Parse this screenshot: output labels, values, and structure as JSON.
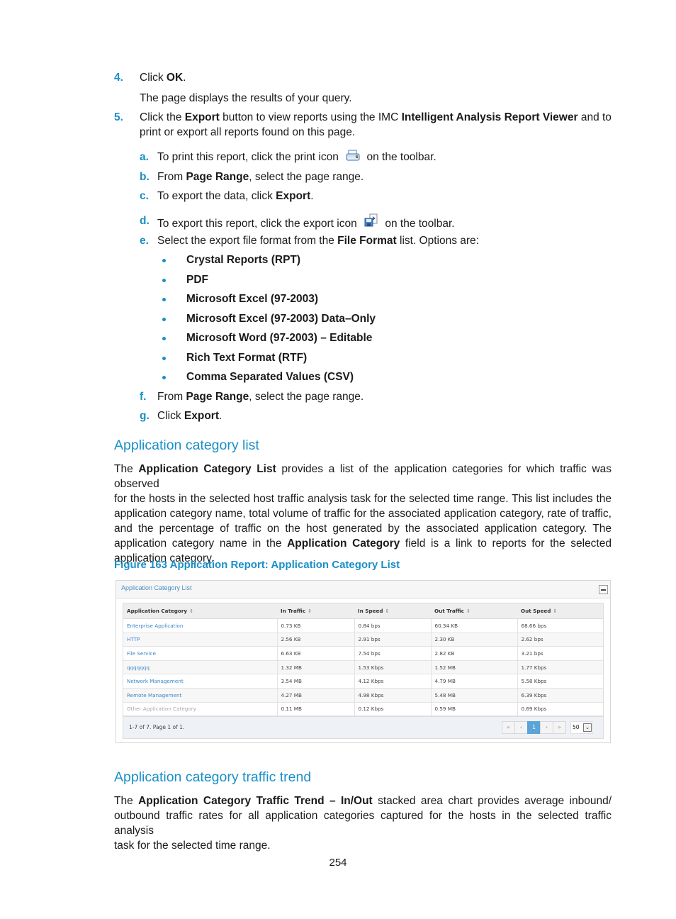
{
  "steps": {
    "step4": {
      "num": "4.",
      "pre": "Click ",
      "bold": "OK",
      "post": ".",
      "note": "The page displays the results of your query."
    },
    "step5": {
      "num": "5.",
      "pre": "Click the ",
      "bold1": "Export",
      "mid": " button to view reports using the IMC ",
      "bold2": "Intelligent Analysis Report Viewer",
      "post": " and to",
      "line2": "print or export all reports found on this page."
    },
    "substeps": {
      "a": {
        "label": "a.",
        "pre": "To print this report, click the print icon",
        "post": "on the toolbar.",
        "icon": "print-icon"
      },
      "b": {
        "label": "b.",
        "pre": "From ",
        "bold": "Page Range",
        "post": ", select the page range."
      },
      "c": {
        "label": "c.",
        "pre": "To export the data, click ",
        "bold": "Export",
        "post": "."
      },
      "d": {
        "label": "d.",
        "pre": "To export this report, click the export icon",
        "post": "on the toolbar.",
        "icon": "export-icon"
      },
      "e": {
        "label": "e.",
        "pre": "Select the export file format from the ",
        "bold": "File Format",
        "post": " list. Options are:"
      },
      "f": {
        "label": "f.",
        "pre": "From ",
        "bold": "Page Range",
        "post": ", select the page range."
      },
      "g": {
        "label": "g.",
        "pre": "Click ",
        "bold": "Export",
        "post": "."
      }
    },
    "formats": [
      "Crystal Reports (RPT)",
      "PDF",
      "Microsoft Excel (97-2003)",
      "Microsoft Excel (97-2003) Data–Only",
      "Microsoft Word (97-2003) – Editable",
      "Rich Text Format (RTF)",
      "Comma Separated Values (CSV)"
    ]
  },
  "section1": {
    "heading": "Application category list",
    "para": {
      "l1_pre": "The ",
      "l1_bold": "Application Category List",
      "l1_post": " provides a list of the application categories for which traffic was observed",
      "l2": "for the hosts in the selected host traffic analysis task for the selected time range. This list includes the",
      "l3": "application category name, total volume of traffic for the associated application category, rate of traffic,",
      "l4": "and the percentage of traffic on the host generated by the associated application category. The",
      "l5_pre": "application category name in the ",
      "l5_bold": "Application Category",
      "l5_post": " field is a link to reports for the selected",
      "l6": "application category."
    },
    "figure_caption": "Figure 163 Application Report: Application Category List"
  },
  "figure": {
    "panel_title": "Application Category List",
    "columns": [
      "Application Category",
      "In Traffic",
      "In Speed",
      "Out Traffic",
      "Out Speed"
    ],
    "rows": [
      {
        "category": "Enterprise Application",
        "in_traffic": "0.73 KB",
        "in_speed": "0.84 bps",
        "out_traffic": "60.34 KB",
        "out_speed": "68.66 bps"
      },
      {
        "category": "HTTP",
        "in_traffic": "2.56 KB",
        "in_speed": "2.91 bps",
        "out_traffic": "2.30 KB",
        "out_speed": "2.62 bps"
      },
      {
        "category": "File Service",
        "in_traffic": "6.63 KB",
        "in_speed": "7.54 bps",
        "out_traffic": "2.82 KB",
        "out_speed": "3.21 bps"
      },
      {
        "category": "qqqqqqq",
        "in_traffic": "1.32 MB",
        "in_speed": "1.53 Kbps",
        "out_traffic": "1.52 MB",
        "out_speed": "1.77 Kbps"
      },
      {
        "category": "Network Management",
        "in_traffic": "3.54 MB",
        "in_speed": "4.12 Kbps",
        "out_traffic": "4.79 MB",
        "out_speed": "5.58 Kbps"
      },
      {
        "category": "Remote Management",
        "in_traffic": "4.27 MB",
        "in_speed": "4.98 Kbps",
        "out_traffic": "5.48 MB",
        "out_speed": "6.39 Kbps"
      },
      {
        "category": "Other Application Category",
        "in_traffic": "0.11 MB",
        "in_speed": "0.12 Kbps",
        "out_traffic": "0.59 MB",
        "out_speed": "0.69 Kbps"
      }
    ],
    "pager": {
      "info": "1-7 of 7. Page 1 of 1.",
      "first": "«",
      "prev": "‹",
      "current": "1",
      "next": "›",
      "last": "»",
      "page_size": "50"
    }
  },
  "section2": {
    "heading": "Application category traffic trend",
    "para": {
      "l1_pre": "The ",
      "l1_bold": "Application Category Traffic Trend – In/Out",
      "l1_post": " stacked area chart provides average inbound/",
      "l2": "outbound traffic rates for all application categories captured for the hosts in the selected traffic analysis",
      "l3": "task for the selected time range."
    }
  },
  "footer": {
    "page_number": "254"
  }
}
